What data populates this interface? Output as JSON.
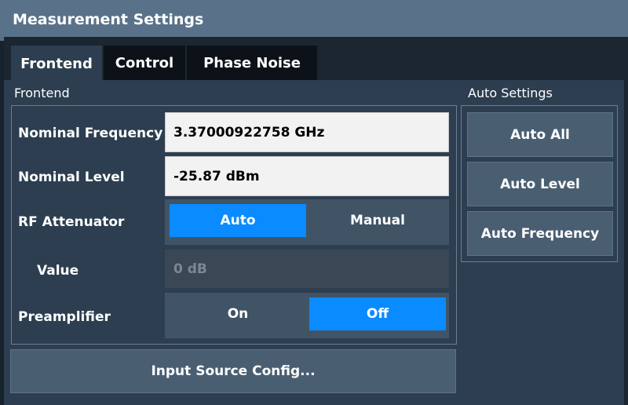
{
  "window": {
    "title": "Measurement Settings"
  },
  "tabs": [
    {
      "label": "Frontend",
      "active": true
    },
    {
      "label": "Control",
      "active": false
    },
    {
      "label": "Phase Noise",
      "active": false
    }
  ],
  "frontend": {
    "group_label": "Frontend",
    "nominal_frequency": {
      "label": "Nominal Frequency",
      "value": "3.37000922758 GHz"
    },
    "nominal_level": {
      "label": "Nominal Level",
      "value": "-25.87 dBm"
    },
    "rf_attenuator": {
      "label": "RF Attenuator",
      "options": [
        "Auto",
        "Manual"
      ],
      "selected": "Auto"
    },
    "value": {
      "label": "Value",
      "value": "0 dB",
      "enabled": false
    },
    "preamplifier": {
      "label": "Preamplifier",
      "options": [
        "On",
        "Off"
      ],
      "selected": "Off"
    }
  },
  "auto_settings": {
    "group_label": "Auto Settings",
    "buttons": [
      "Auto All",
      "Auto Level",
      "Auto Frequency"
    ]
  },
  "input_source_button": "Input Source Config...",
  "colors": {
    "accent": "#0a8bff",
    "title_bar": "#59728a",
    "panel": "#2c3e50"
  }
}
